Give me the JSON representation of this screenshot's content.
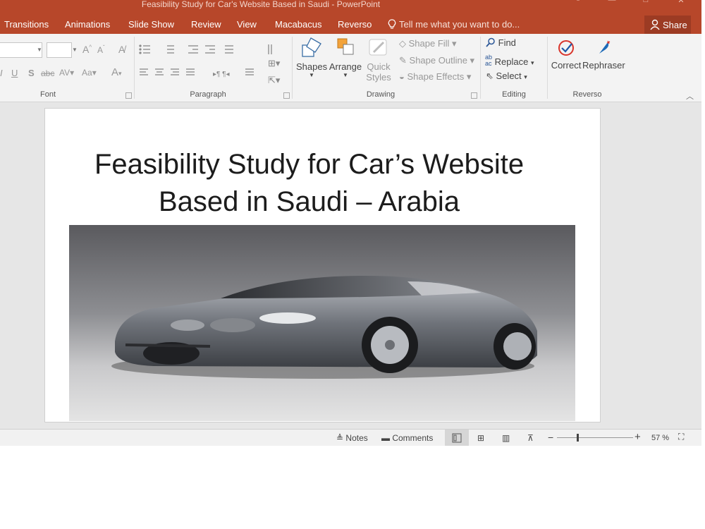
{
  "window": {
    "title": "Feasibility Study for Car's Website Based in Saudi - PowerPoint"
  },
  "tabs": [
    "Transitions",
    "Animations",
    "Slide Show",
    "Review",
    "View",
    "Macabacus",
    "Reverso"
  ],
  "tell_me": "Tell me what you want to do...",
  "share_label": "Share",
  "ribbon": {
    "groups": {
      "font": "Font",
      "paragraph": "Paragraph",
      "drawing": "Drawing",
      "editing": "Editing",
      "reverso": "Reverso"
    },
    "font": {
      "case_label": "Aa",
      "font_color_label": "A"
    },
    "drawing": {
      "shapes": "Shapes",
      "arrange": "Arrange",
      "quick_styles_1": "Quick",
      "quick_styles_2": "Styles",
      "shape_fill": "Shape Fill",
      "shape_outline": "Shape Outline",
      "shape_effects": "Shape Effects"
    },
    "editing": {
      "find": "Find",
      "replace": "Replace",
      "select": "Select"
    },
    "reverso": {
      "correct": "Correct",
      "rephraser": "Rephraser"
    }
  },
  "slide": {
    "title_line1": "Feasibility Study for Car’s Website",
    "title_line2": "Based in Saudi – Arabia"
  },
  "status": {
    "notes": "Notes",
    "comments": "Comments",
    "zoom": "57 %",
    "zoom_level": 0.57
  }
}
